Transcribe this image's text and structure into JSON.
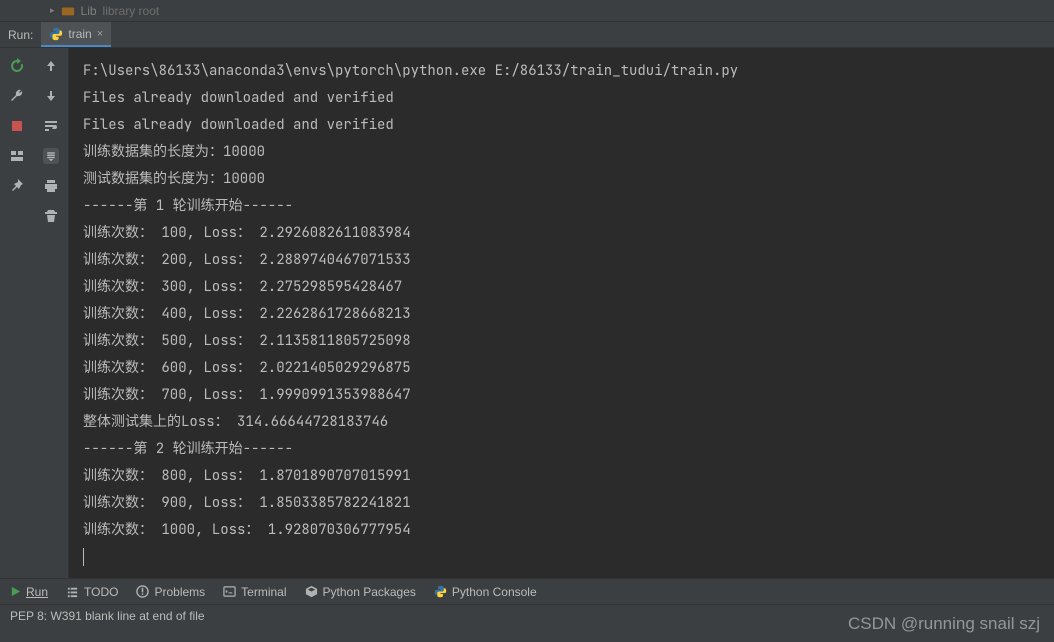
{
  "topbar": {
    "lib_name": "Lib",
    "lib_tag": "library root"
  },
  "run": {
    "label": "Run:",
    "tab_name": "train"
  },
  "console_lines": [
    "F:\\Users\\86133\\anaconda3\\envs\\pytorch\\python.exe E:/86133/train_tudui/train.py",
    "Files already downloaded and verified",
    "Files already downloaded and verified",
    "训练数据集的长度为：10000",
    "测试数据集的长度为：10000",
    "------第 1 轮训练开始------",
    "训练次数： 100, Loss： 2.2926082611083984",
    "训练次数： 200, Loss： 2.2889740467071533",
    "训练次数： 300, Loss： 2.275298595428467",
    "训练次数： 400, Loss： 2.2262861728668213",
    "训练次数： 500, Loss： 2.1135811805725098",
    "训练次数： 600, Loss： 2.0221405029296875",
    "训练次数： 700, Loss： 1.9990991353988647",
    "整体测试集上的Loss： 314.66644728183746",
    "------第 2 轮训练开始------",
    "训练次数： 800, Loss： 1.8701890707015991",
    "训练次数： 900, Loss： 1.8503385782241821",
    "训练次数： 1000, Loss： 1.928070306777954"
  ],
  "bottom_tools": {
    "run": "Run",
    "todo": "TODO",
    "problems": "Problems",
    "terminal": "Terminal",
    "packages": "Python Packages",
    "pyconsole": "Python Console"
  },
  "status": {
    "message": "PEP 8: W391 blank line at end of file"
  },
  "watermark": "CSDN @running snail szj"
}
